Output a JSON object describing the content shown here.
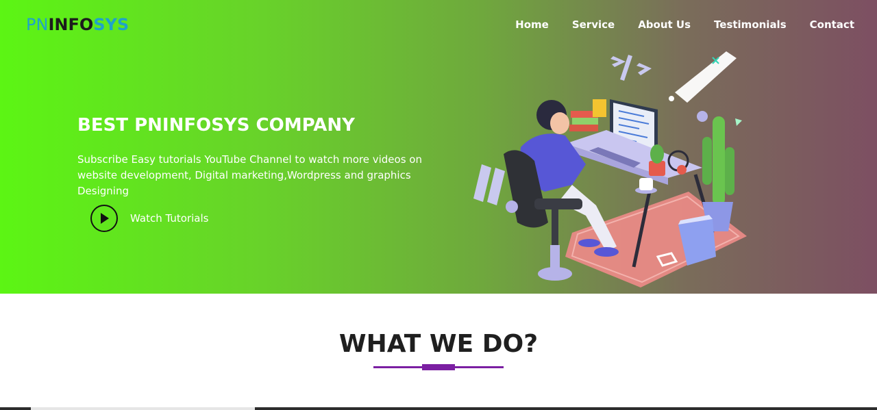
{
  "header": {
    "logo": {
      "part1": "PN",
      "part2": "INFO",
      "part3": "SYS"
    },
    "nav": [
      "Home",
      "Service",
      "About Us",
      "Testimonials",
      "Contact"
    ]
  },
  "hero": {
    "title": "BEST PNINFOSYS COMPANY",
    "subtitle": "Subscribe Easy tutorials YouTube Channel to watch more videos on website development, Digital marketing,Wordpress and graphics Designing",
    "cta_label": "Watch Tutorials",
    "cta_icon": "play-icon",
    "gradient_start": "#5cf514",
    "gradient_end": "#7d4f62"
  },
  "section": {
    "title": "WHAT WE DO?",
    "accent_color": "#7b1fa2"
  }
}
